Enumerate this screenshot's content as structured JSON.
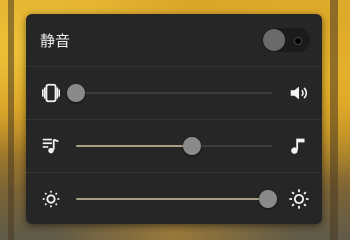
{
  "mute": {
    "label": "静音",
    "enabled": false
  },
  "sliders": [
    {
      "name": "ringer",
      "left_icon": "vibrate-icon",
      "right_icon": "speaker-volume-icon",
      "value": 0.0
    },
    {
      "name": "media",
      "left_icon": "music-notes-icon",
      "right_icon": "music-note-icon",
      "value": 0.59
    },
    {
      "name": "brightness",
      "left_icon": "brightness-low-icon",
      "right_icon": "brightness-high-icon",
      "value": 0.98
    }
  ],
  "colors": {
    "panel": "#262626",
    "slider_fill": "#a99f86",
    "thumb": "#8a8a8a"
  }
}
